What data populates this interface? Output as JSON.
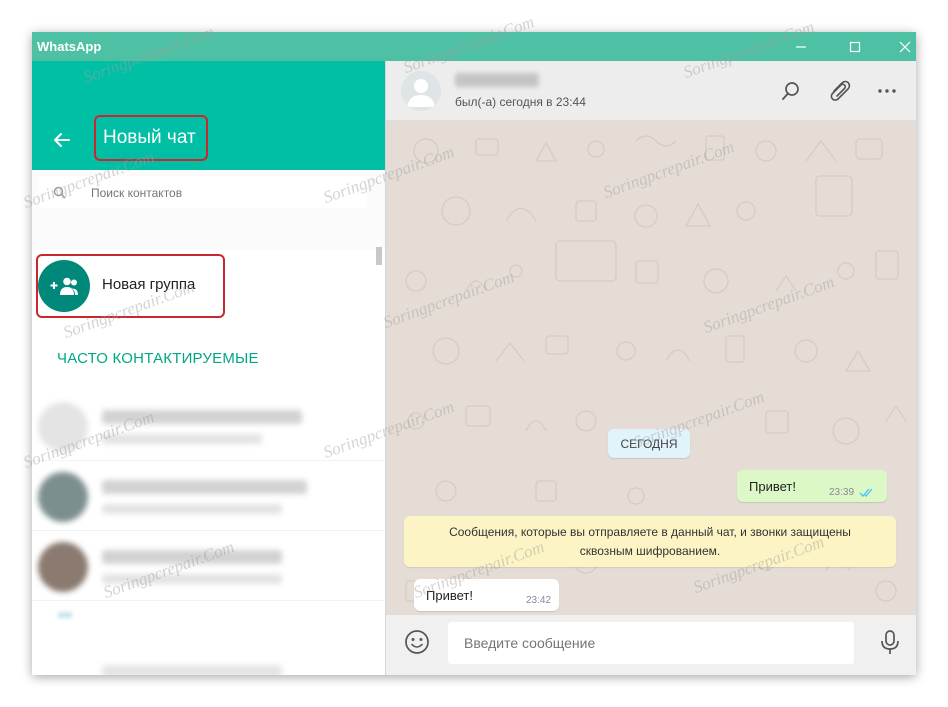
{
  "window": {
    "title": "WhatsApp"
  },
  "left_panel": {
    "title": "Новый чат",
    "search": {
      "placeholder": "Поиск контактов"
    },
    "new_group_label": "Новая группа",
    "section_title": "ЧАСТО КОНТАКТИРУЕМЫЕ"
  },
  "chat": {
    "last_seen": "был(-а) сегодня в 23:44",
    "date_divider": "СЕГОДНЯ",
    "messages": [
      {
        "direction": "out",
        "text": "Привет!",
        "time": "23:39",
        "status": "read"
      },
      {
        "direction": "in",
        "text": "Привет!",
        "time": "23:42"
      }
    ],
    "encryption_notice": {
      "line1": "Сообщения, которые вы отправляете в данный чат, и звонки защищены",
      "line2": "сквозным шифрованием."
    },
    "composer": {
      "placeholder": "Введите сообщение"
    }
  },
  "watermark": "Soringpcrepair.Com",
  "colors": {
    "header_teal": "#00bfa5",
    "titlebar": "#4ec0a4",
    "accent_green": "#00a884",
    "group_avatar": "#00897b",
    "highlight_red": "#c8282d",
    "outgoing_bubble": "#dcf8c6",
    "notice_bubble": "#fcf4c4",
    "date_pill": "#e1f3fb"
  },
  "icons": {
    "titlebar": [
      "minimize-icon",
      "maximize-icon",
      "close-icon"
    ],
    "left_header": "back-arrow-icon",
    "search": "search-icon",
    "new_group": "group-add-icon",
    "chat_header": [
      "search-icon",
      "paperclip-icon",
      "more-vertical-icon"
    ],
    "composer": [
      "emoji-icon",
      "microphone-icon"
    ],
    "message_status": "double-check-icon"
  }
}
